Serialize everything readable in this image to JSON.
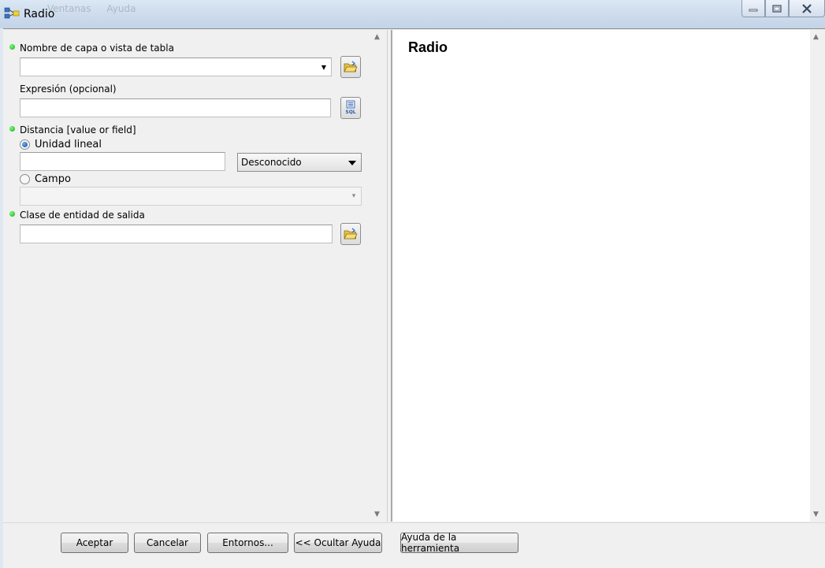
{
  "window": {
    "title": "Radio",
    "ghost_menu": [
      "Ventanas",
      "Ayuda"
    ]
  },
  "form": {
    "input_layer_label": "Nombre de capa o vista de tabla",
    "input_layer_value": "",
    "expression_label": "Expresión (opcional)",
    "expression_value": "",
    "sql_button_label": "SQL",
    "distance_label": "Distancia [value or field]",
    "linear_unit_label": "Unidad lineal",
    "linear_unit_selected": true,
    "linear_unit_value": "",
    "unit_select_value": "Desconocido",
    "field_label": "Campo",
    "field_selected": false,
    "field_value": "",
    "output_label": "Clase de entidad de salida",
    "output_value": ""
  },
  "help": {
    "title": "Radio"
  },
  "buttons": {
    "ok": "Aceptar",
    "cancel": "Cancelar",
    "environments": "Entornos...",
    "hide_help": "<< Ocultar Ayuda",
    "tool_help": "Ayuda de la herramienta"
  },
  "colors": {
    "required_dot": "#14a814",
    "radio_selected": "#104f9c"
  }
}
